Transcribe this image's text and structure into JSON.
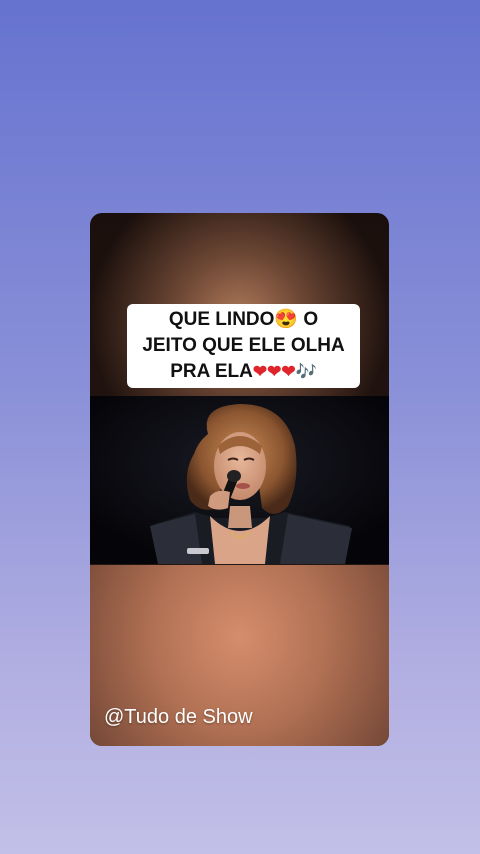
{
  "caption": {
    "line1": "QUE LINDO😍 O",
    "line2": "JEITO QUE ELE OLHA",
    "line3_text": "PRA ELA",
    "line3_hearts": "❤❤❤",
    "line3_notes": "🎶"
  },
  "video": {
    "description_icon": "singer-with-microphone-icon"
  },
  "watermark": "@Tudo de Show",
  "colors": {
    "background_top": "#6673cf",
    "background_bottom": "#c2bfe8",
    "caption_bg": "#ffffff",
    "heart": "#e0242c"
  }
}
